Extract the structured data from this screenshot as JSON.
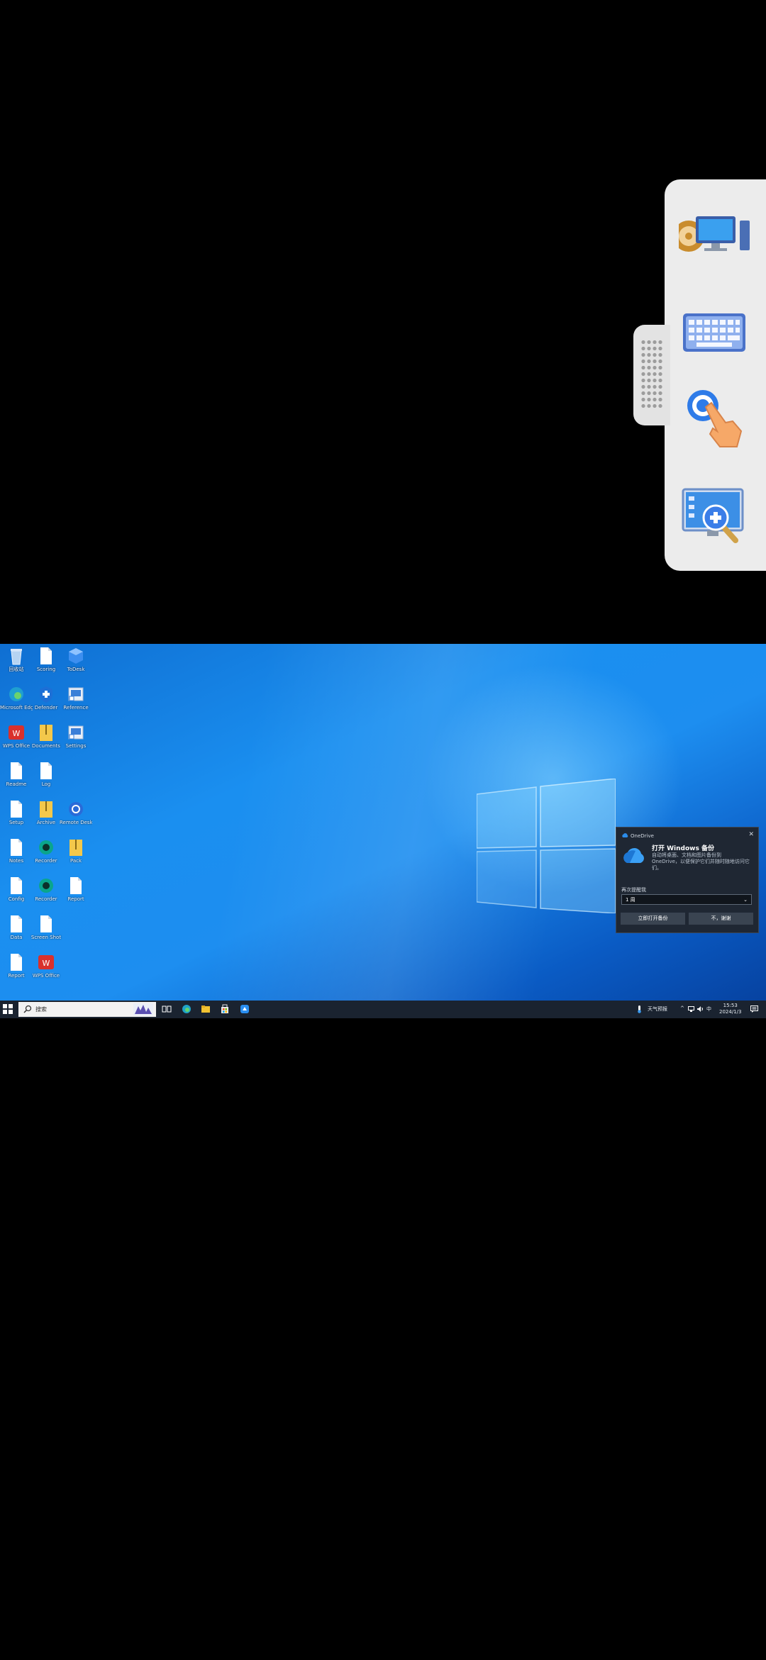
{
  "desktop_icons": [
    {
      "label": "回收站",
      "icon": "recycle-bin-icon"
    },
    {
      "label": "Scoring",
      "icon": "document-icon"
    },
    {
      "label": "ToDesk",
      "icon": "app-cube-icon"
    },
    {
      "label": "Microsoft Edge",
      "icon": "edge-icon"
    },
    {
      "label": "Defender",
      "icon": "shield-icon"
    },
    {
      "label": "Reference",
      "icon": "shortcut-icon"
    },
    {
      "label": "WPS Office",
      "icon": "wps-icon"
    },
    {
      "label": "Documents",
      "icon": "folder-zip-icon"
    },
    {
      "label": "Settings",
      "icon": "shortcut-icon"
    },
    {
      "label": "Readme",
      "icon": "document-icon"
    },
    {
      "label": "Log",
      "icon": "document-icon"
    },
    {
      "label": "Setup",
      "icon": "document-icon"
    },
    {
      "label": "Archive",
      "icon": "folder-zip-icon"
    },
    {
      "label": "Remote Desktop",
      "icon": "remote-desktop-icon"
    },
    {
      "label": "Notes",
      "icon": "document-icon"
    },
    {
      "label": "Recorder",
      "icon": "recorder-icon"
    },
    {
      "label": "Pack",
      "icon": "folder-zip-icon"
    },
    {
      "label": "Config",
      "icon": "document-icon"
    },
    {
      "label": "Recorder",
      "icon": "recorder-icon"
    },
    {
      "label": "Report",
      "icon": "document-icon"
    },
    {
      "label": "Data",
      "icon": "document-icon"
    },
    {
      "label": "Screen Shot",
      "icon": "document-icon"
    },
    {
      "label": "Report",
      "icon": "document-icon"
    },
    {
      "label": "WPS Office",
      "icon": "wps-icon"
    }
  ],
  "toast": {
    "app_name": "OneDrive",
    "title": "打开 Windows 备份",
    "body": "自动将桌面、文档和图片备份到 OneDrive，以便保护它们并随时随地访问它们。",
    "select_label": "再次提醒我",
    "select_value": "1 周",
    "primary_button": "立即打开备份",
    "secondary_button": "不，谢谢"
  },
  "taskbar": {
    "search_placeholder": "搜索",
    "weather": "天气预报",
    "time": "15:53",
    "date": "2024/1/3"
  },
  "floating_toolbar": {
    "tools": [
      "display-switch-icon",
      "keyboard-icon",
      "touch-mode-icon",
      "zoom-screen-icon"
    ]
  },
  "colors": {
    "accent": "#0f7be0",
    "taskbar": "#1a2330",
    "toast_bg": "#1f2733"
  }
}
